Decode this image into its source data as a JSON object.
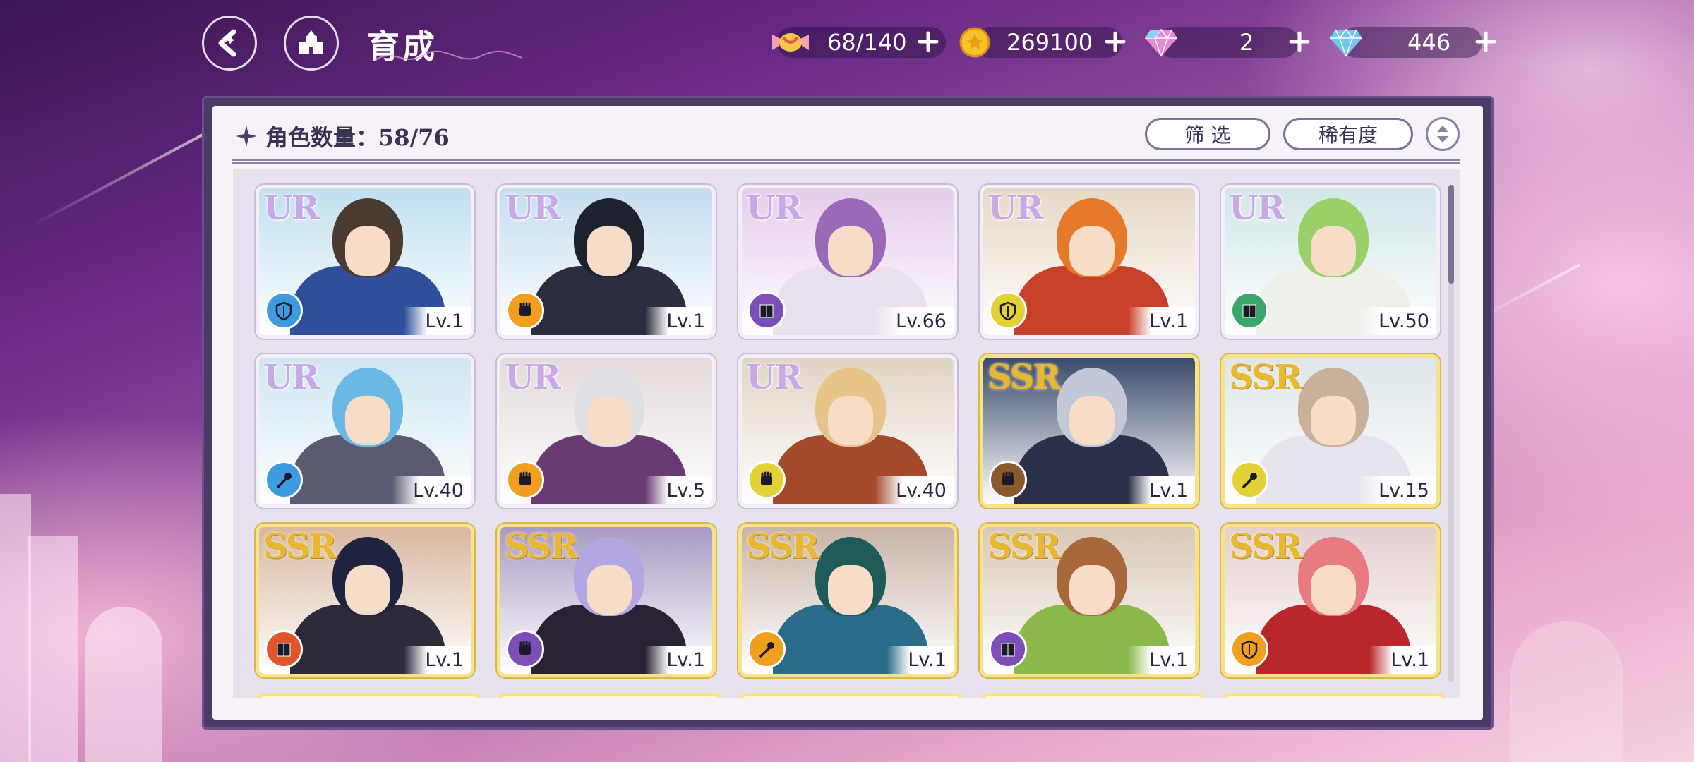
{
  "header": {
    "title": "育成",
    "resources": [
      {
        "name": "candy",
        "value": "68/140"
      },
      {
        "name": "gold-coin",
        "value": "269100"
      },
      {
        "name": "rainbow-gem",
        "value": "2"
      },
      {
        "name": "blue-diamond",
        "value": "446"
      }
    ]
  },
  "panel": {
    "count_label": "角色数量：58/76",
    "filter_label": "筛 选",
    "rarity_sort_label": "稀有度"
  },
  "colors": {
    "element_blue": "#3d9ce0",
    "element_orange": "#f0a01e",
    "element_purple": "#7b4fb6",
    "element_yellow": "#e2d235",
    "element_green": "#3aa76a",
    "element_brown": "#8a5a2c",
    "element_red": "#e0562a"
  },
  "cards": [
    {
      "rarity": "UR",
      "level": "Lv.1",
      "element": "blue",
      "icon": "shield-icon",
      "hair": "#4a3a30",
      "outfit": "#2f4f9a",
      "bg": "#bfe0f0"
    },
    {
      "rarity": "UR",
      "level": "Lv.1",
      "element": "orange",
      "icon": "fist-icon",
      "hair": "#1e2230",
      "outfit": "#2a2e40",
      "bg": "#c4ddf0"
    },
    {
      "rarity": "UR",
      "level": "Lv.66",
      "element": "purple",
      "icon": "book-icon",
      "hair": "#9a6ab8",
      "outfit": "#e9e2ee",
      "bg": "#e4cdea"
    },
    {
      "rarity": "UR",
      "level": "Lv.1",
      "element": "yellow",
      "icon": "shield-icon",
      "hair": "#e57a2a",
      "outfit": "#c9402a",
      "bg": "#e6d8c6"
    },
    {
      "rarity": "UR",
      "level": "Lv.50",
      "element": "green",
      "icon": "book-icon",
      "hair": "#9ad06a",
      "outfit": "#eef0ea",
      "bg": "#d2e6e8"
    },
    {
      "rarity": "UR",
      "level": "Lv.40",
      "element": "blue",
      "icon": "wand-icon",
      "hair": "#6ab8e4",
      "outfit": "#5a5a72",
      "bg": "#cfe6f0"
    },
    {
      "rarity": "UR",
      "level": "Lv.5",
      "element": "orange",
      "icon": "fist-icon",
      "hair": "#dfe0e4",
      "outfit": "#6a3a72",
      "bg": "#e4dada"
    },
    {
      "rarity": "UR",
      "level": "Lv.40",
      "element": "yellow",
      "icon": "fist-icon",
      "hair": "#e8c48a",
      "outfit": "#a44a2a",
      "bg": "#e0d4c6"
    },
    {
      "rarity": "SSR",
      "level": "Lv.1",
      "element": "brown",
      "icon": "fist-icon",
      "hair": "#c2c8d8",
      "outfit": "#2a3048",
      "bg": "#3a4a6a"
    },
    {
      "rarity": "SSR",
      "level": "Lv.15",
      "element": "yellow",
      "icon": "wand-icon",
      "hair": "#c9b098",
      "outfit": "#e8e4ee",
      "bg": "#dde6ea"
    },
    {
      "rarity": "SSR",
      "level": "Lv.1",
      "element": "red",
      "icon": "book-icon",
      "hair": "#1e2440",
      "outfit": "#2e2a3a",
      "bg": "#d8b8a0"
    },
    {
      "rarity": "SSR",
      "level": "Lv.1",
      "element": "purple",
      "icon": "fist-icon",
      "hair": "#b4a6e2",
      "outfit": "#2a2232",
      "bg": "#a89ac2"
    },
    {
      "rarity": "SSR",
      "level": "Lv.1",
      "element": "orange",
      "icon": "wand-icon",
      "hair": "#1e5a5a",
      "outfit": "#2a6a8a",
      "bg": "#c8b4a8"
    },
    {
      "rarity": "SSR",
      "level": "Lv.1",
      "element": "purple",
      "icon": "book-icon",
      "hair": "#a8683a",
      "outfit": "#8ab84a",
      "bg": "#d8c8b8"
    },
    {
      "rarity": "SSR",
      "level": "Lv.1",
      "element": "orange",
      "icon": "shield-icon",
      "hair": "#e87a82",
      "outfit": "#b8282a",
      "bg": "#e4cfcf"
    }
  ]
}
